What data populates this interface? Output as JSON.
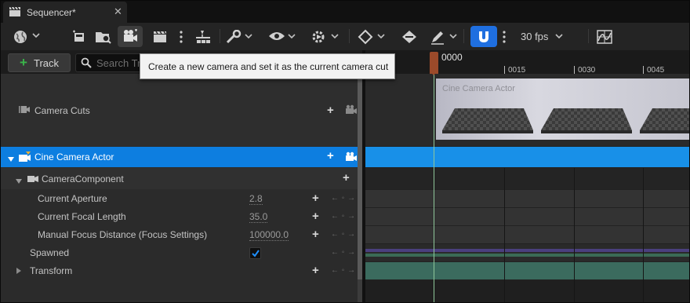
{
  "tab": {
    "title": "Sequencer*",
    "close": "✕"
  },
  "toolbar": {
    "fps_label": "30 fps",
    "colors": {
      "snap_active": "#1f6fe0",
      "background": "#242424"
    }
  },
  "left_header": {
    "track_button_label": "Track",
    "search_placeholder": "Search Tracks"
  },
  "tooltip": {
    "text": "Create a new camera and set it as the current camera cut"
  },
  "tracks": {
    "camera_cuts": {
      "label": "Camera Cuts"
    },
    "cine_camera_actor": {
      "label": "Cine Camera Actor"
    },
    "camera_component": {
      "label": "CameraComponent"
    },
    "properties": [
      {
        "label": "Current Aperture",
        "value": "2.8"
      },
      {
        "label": "Current Focal Length",
        "value": "35.0"
      },
      {
        "label": "Manual Focus Distance (Focus Settings)",
        "value": "100000.0"
      }
    ],
    "spawned": {
      "label": "Spawned",
      "checked": true
    },
    "transform": {
      "label": "Transform"
    }
  },
  "timeline": {
    "current_frame": "0000",
    "ticks": [
      "0015",
      "0030",
      "0045"
    ],
    "camera_cut_clip_label": "Cine Camera Actor",
    "colors": {
      "selected_row": "#0d7ee0",
      "selected_track": "#1890e8",
      "spawned_purple": "#4a3f7e",
      "spawned_green": "#3a6a55",
      "transform_teal": "#3b6b5e",
      "playhead": "#9b4a2a"
    }
  }
}
